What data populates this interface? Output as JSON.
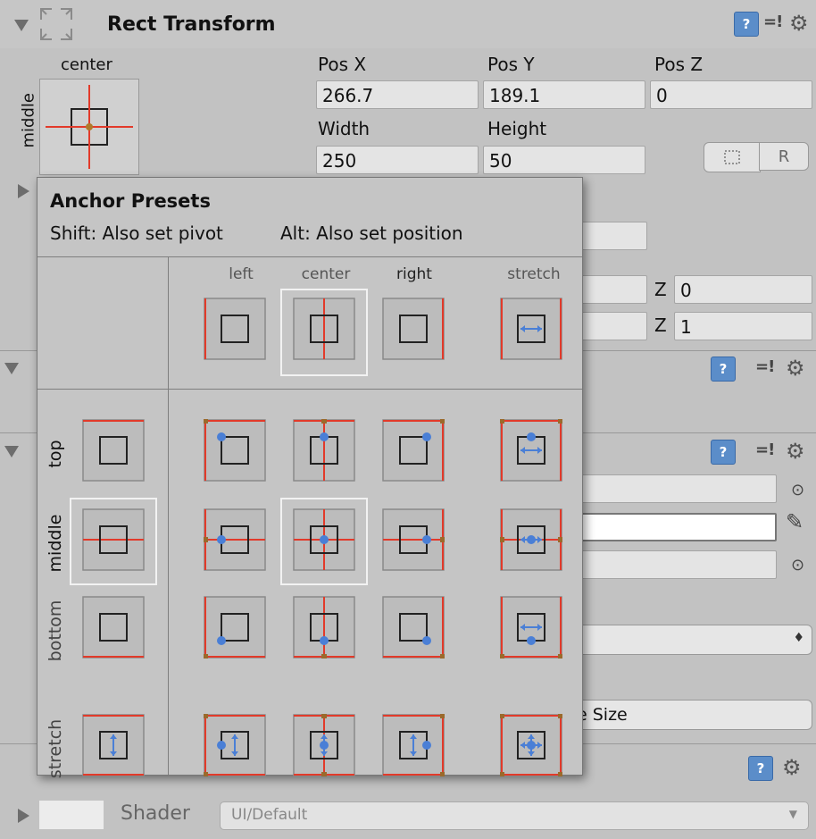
{
  "component": {
    "title": "Rect Transform",
    "anchor_h_label": "center",
    "anchor_v_label": "middle",
    "pos_x_label": "Pos X",
    "pos_x": "266.7",
    "pos_y_label": "Pos Y",
    "pos_y": "189.1",
    "pos_z_label": "Pos Z",
    "pos_z": "0",
    "width_label": "Width",
    "width": "250",
    "height_label": "Height",
    "height": "50",
    "raw_button": "R"
  },
  "background_rows": {
    "z1_label": "Z",
    "z1_value": "0",
    "z2_label": "Z",
    "z2_value": "1",
    "size_button": "e Size",
    "shader_label": "Shader",
    "shader_value": "UI/Default"
  },
  "presets": {
    "title": "Anchor Presets",
    "hint_shift": "Shift: Also set pivot",
    "hint_alt": "Alt: Also set position",
    "columns": [
      "left",
      "center",
      "right",
      "stretch"
    ],
    "rows": [
      "top",
      "middle",
      "bottom",
      "stretch"
    ],
    "selected": {
      "column": "center",
      "row": "middle"
    },
    "anchor_color": "#e23a2a",
    "pivot_color": "#4a7fd6",
    "corner_color": "#9a6a2c"
  }
}
